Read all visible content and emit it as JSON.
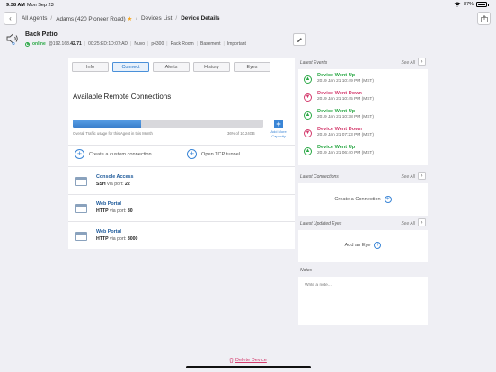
{
  "status_bar": {
    "time": "9:38 AM",
    "date": "Mon Sep 23",
    "battery": "87%"
  },
  "nav": {
    "crumbs": [
      "All Agents",
      "Adams (420 Pioneer Road)",
      "Devices List",
      "Device Details"
    ],
    "star": "★"
  },
  "device": {
    "name": "Back Patio",
    "status": "online",
    "ip_prefix": "@192.168.",
    "ip_suffix": "42.71",
    "mac": "00:25:ED:1D:07:AD",
    "tags": [
      "Nuvo",
      "p4300",
      "Rack Room",
      "Basement",
      "Important"
    ]
  },
  "tabs": [
    {
      "label": "Info",
      "active": false
    },
    {
      "label": "Connect",
      "active": true
    },
    {
      "label": "Alerts",
      "active": false
    },
    {
      "label": "History",
      "active": false
    },
    {
      "label": "Eyes",
      "active": false
    }
  ],
  "connections": {
    "title": "Available Remote Connections",
    "usage_label": "Overall Traffic usage for this Agent in this Month",
    "usage_value": "36% of 10.24GB",
    "usage_percent": 36,
    "add_capacity": "Add More Capacity",
    "create_custom": "Create a custom connection",
    "open_tcp": "Open TCP tunnel",
    "items": [
      {
        "name": "Console Access",
        "protocol": "SSH",
        "via": "via port:",
        "port": "22"
      },
      {
        "name": "Web Portal",
        "protocol": "HTTP",
        "via": "via port:",
        "port": "80"
      },
      {
        "name": "Web Portal",
        "protocol": "HTTP",
        "via": "via port:",
        "port": "8000"
      }
    ]
  },
  "latest_events": {
    "title": "Latest Events",
    "see_all": "See All",
    "items": [
      {
        "title": "Device Went Up",
        "time": "2019 Jan 21 10:49 PM (MST)",
        "type": "up"
      },
      {
        "title": "Device Went Down",
        "time": "2019 Jan 21 10:45 PM (MST)",
        "type": "down"
      },
      {
        "title": "Device Went Up",
        "time": "2019 Jan 21 10:38 PM (MST)",
        "type": "up"
      },
      {
        "title": "Device Went Down",
        "time": "2019 Jan 21 07:23 PM (MST)",
        "type": "down"
      },
      {
        "title": "Device Went Up",
        "time": "2019 Jan 21 06:40 PM (MST)",
        "type": "up"
      }
    ]
  },
  "latest_connections": {
    "title": "Latest Connections",
    "see_all": "See All",
    "action": "Create a Connection"
  },
  "latest_eyes": {
    "title": "Latest Updated Eyes",
    "see_all": "See All",
    "action": "Add an Eye"
  },
  "notes": {
    "title": "Notes",
    "placeholder": "Write a note..."
  },
  "delete_label": "Delete Device",
  "colors": {
    "online": "#2aa845",
    "down": "#d43c6e",
    "accent": "#3a85d6"
  }
}
